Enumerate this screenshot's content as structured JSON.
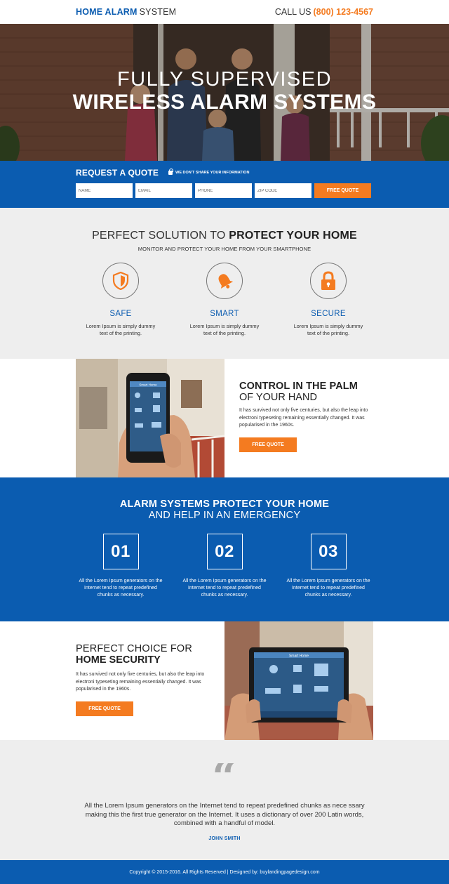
{
  "header": {
    "logo_bold": "HOME ALARM",
    "logo_light": "SYSTEM",
    "call_label": "CALL US",
    "phone": "(800) 123-4567"
  },
  "hero": {
    "line1": "FULLY SUPERVISED",
    "line2": "WIRELESS ALARM SYSTEMS"
  },
  "quote_form": {
    "title": "REQUEST A QUOTE",
    "privacy_note": "WE DON'T SHARE YOUR INFORMATION",
    "fields": [
      {
        "placeholder": "NAME"
      },
      {
        "placeholder": "EMAIL"
      },
      {
        "placeholder": "PHONE"
      },
      {
        "placeholder": "ZIP CODE"
      }
    ],
    "submit_label": "FREE QUOTE"
  },
  "solution": {
    "title_light": "PERFECT SOLUTION TO",
    "title_bold": "PROTECT YOUR HOME",
    "subtitle": "MONITOR AND PROTECT YOUR HOME FROM YOUR SMARTPHONE",
    "features": [
      {
        "name": "SAFE",
        "icon": "shield-icon",
        "text": "Lorem Ipsum is simply dummy text of the printing."
      },
      {
        "name": "SMART",
        "icon": "bell-icon",
        "text": "Lorem Ipsum is simply dummy text of the printing."
      },
      {
        "name": "SECURE",
        "icon": "lock-icon",
        "text": "Lorem Ipsum is simply dummy text of the printing."
      }
    ]
  },
  "control": {
    "heading_bold": "CONTROL IN THE PALM",
    "heading_light": "OF YOUR HAND",
    "body": "It has survived not only five centuries, but also the leap into electroni typeseting remaining essentially changed. It was popularised in the 1960s.",
    "button": "FREE QUOTE",
    "phone_screen_title": "Smart Home"
  },
  "alarm": {
    "heading_bold": "ALARM SYSTEMS PROTECT YOUR HOME",
    "heading_light": "AND HELP IN AN EMERGENCY",
    "steps": [
      {
        "number": "01",
        "text": "All the Lorem Ipsum generators on the Internet tend to repeat predefined chunks as necessary."
      },
      {
        "number": "02",
        "text": "All the Lorem Ipsum generators on the Internet tend to repeat predefined chunks as necessary."
      },
      {
        "number": "03",
        "text": "All the Lorem Ipsum generators on the Internet tend to repeat predefined chunks as necessary."
      }
    ]
  },
  "choice": {
    "heading_light": "PERFECT CHOICE FOR",
    "heading_bold": "HOME SECURITY",
    "body": "It has survived not only five centuries, but also the leap into electroni typeseting remaining essentially changed. It was popularised in the 1960s.",
    "button": "FREE QUOTE",
    "tablet_screen_title": "Smart Home"
  },
  "testimonial": {
    "quote": "All the Lorem Ipsum generators on the Internet tend to repeat predefined chunks as nece ssary making this the first true generator on the Internet. It uses a dictionary of over 200 Latin words, combined with a handful of model.",
    "author": "JOHN SMITH"
  },
  "footer": {
    "text": "Copyright © 2015-2016. All Rights Reserved  |  Designed by: buylandingpagedesign.com"
  },
  "colors": {
    "brand_blue": "#0b5cb0",
    "accent_orange": "#f47b20",
    "light_gray": "#eeeeee"
  }
}
